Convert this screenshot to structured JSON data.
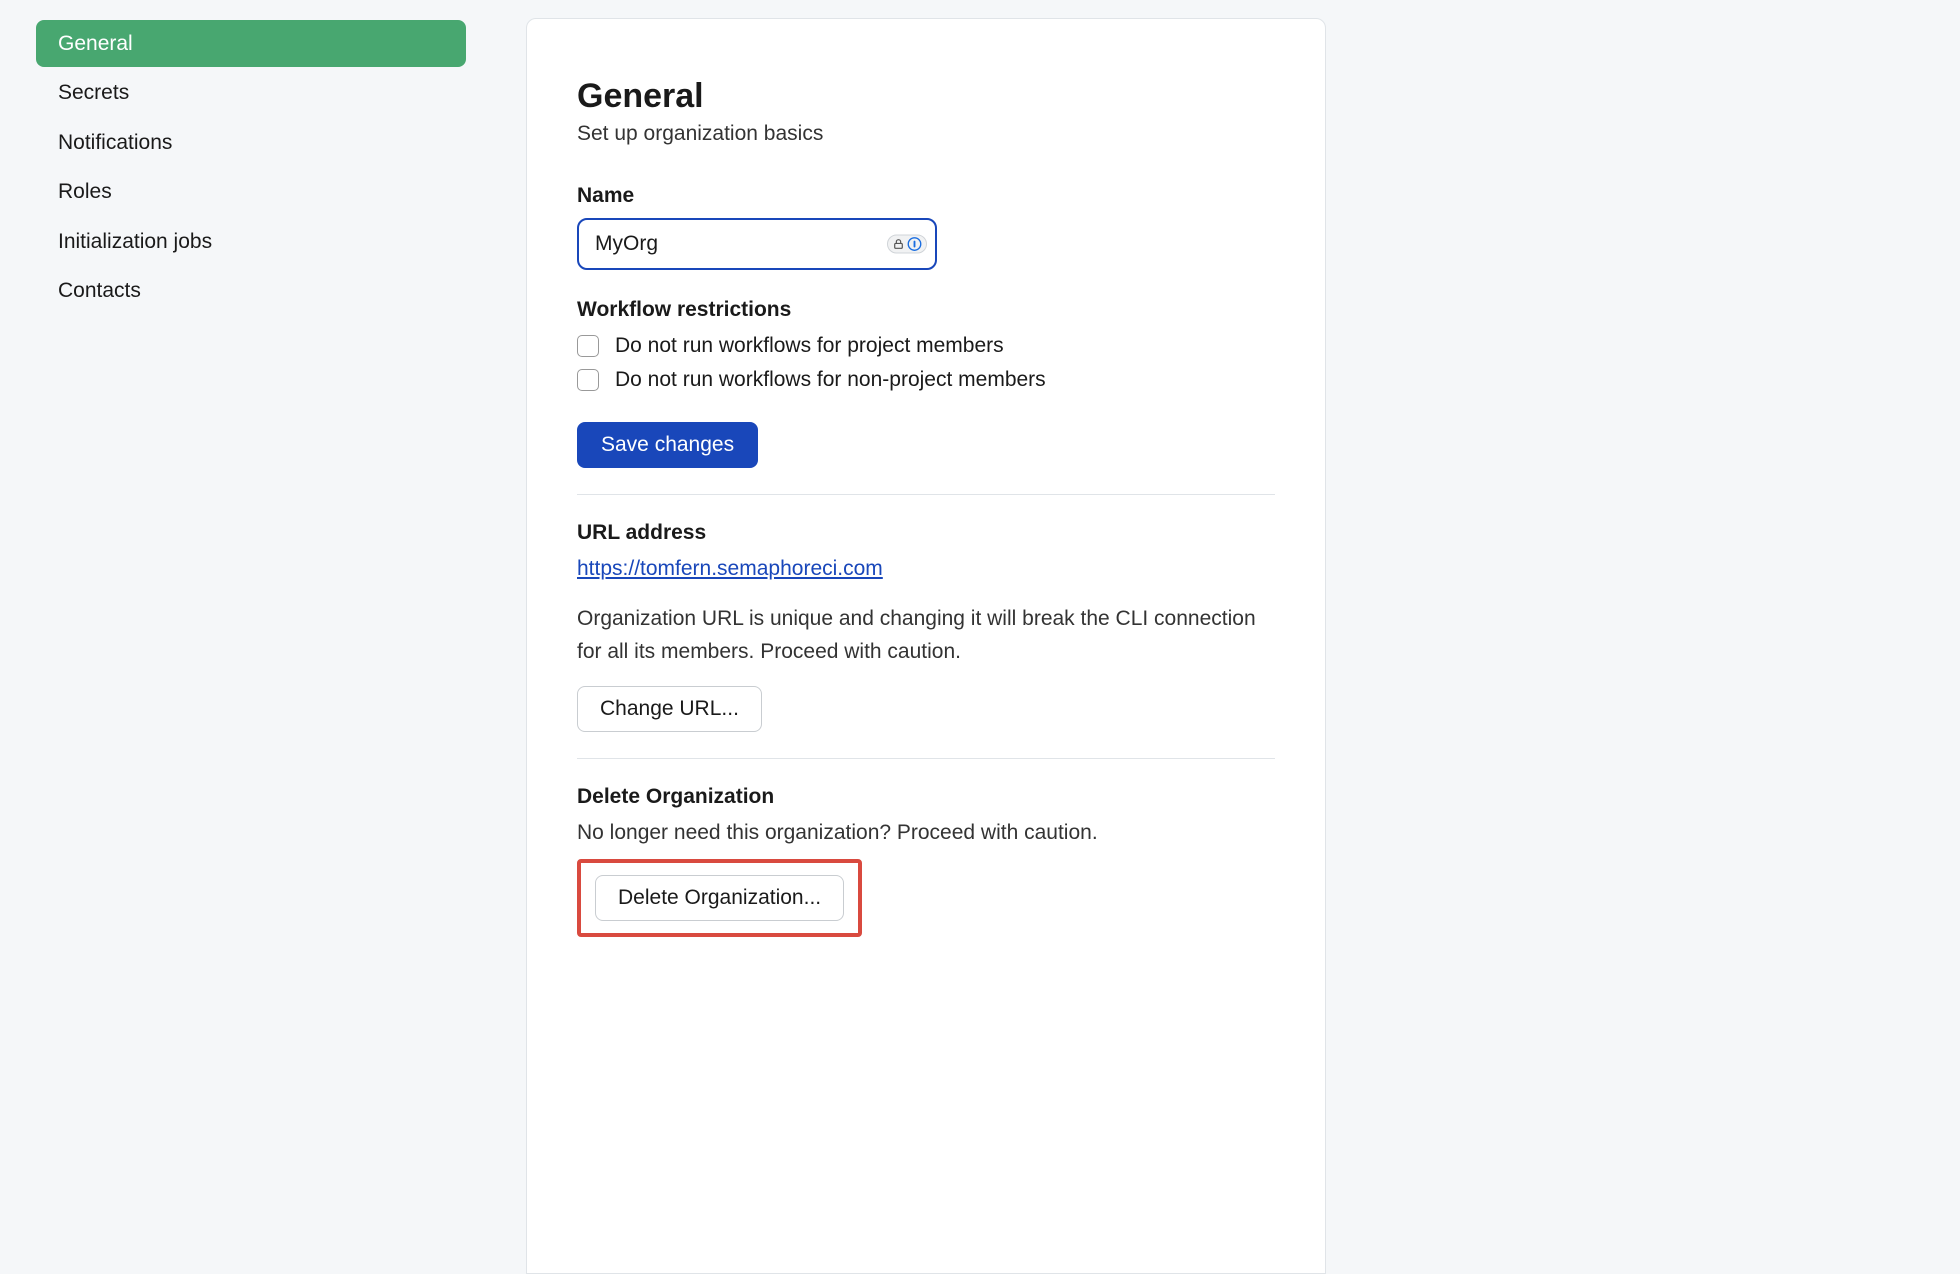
{
  "sidebar": {
    "items": [
      {
        "label": "General",
        "active": true
      },
      {
        "label": "Secrets",
        "active": false
      },
      {
        "label": "Notifications",
        "active": false
      },
      {
        "label": "Roles",
        "active": false
      },
      {
        "label": "Initialization jobs",
        "active": false
      },
      {
        "label": "Contacts",
        "active": false
      }
    ]
  },
  "main": {
    "title": "General",
    "subtitle": "Set up organization basics",
    "name_label": "Name",
    "name_value": "MyOrg",
    "workflow_heading": "Workflow restrictions",
    "checkbox1_label": "Do not run workflows for project members",
    "checkbox2_label": "Do not run workflows for non-project members",
    "save_button": "Save changes",
    "url_heading": "URL address",
    "url_value": "https://tomfern.semaphoreci.com",
    "url_caution": "Organization URL is unique and changing it will break the CLI connection for all its members. Proceed with caution.",
    "change_url_button": "Change URL...",
    "delete_heading": "Delete Organization",
    "delete_subtext": "No longer need this organization? Proceed with caution.",
    "delete_button": "Delete Organization..."
  }
}
